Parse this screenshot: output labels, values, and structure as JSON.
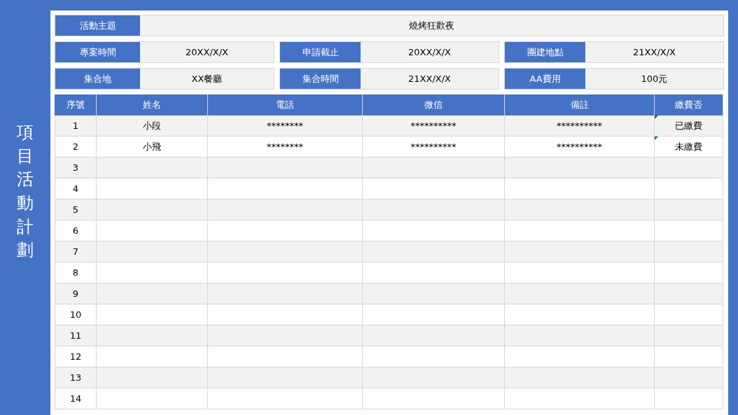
{
  "sidebar_title": "項目活動計劃",
  "info_rows": [
    [
      {
        "label": "活動主題",
        "value": "燒烤狂歡夜"
      }
    ],
    [
      {
        "label": "專案時間",
        "value": "20XX/X/X"
      },
      {
        "label": "申請截止",
        "value": "20XX/X/X"
      },
      {
        "label": "團建地點",
        "value": "21XX/X/X"
      }
    ],
    [
      {
        "label": "集合地",
        "value": "XX餐廳"
      },
      {
        "label": "集合時間",
        "value": "21XX/X/X"
      },
      {
        "label": "AA費用",
        "value": "100元"
      }
    ]
  ],
  "table": {
    "columns": [
      "序號",
      "姓名",
      "電話",
      "微信",
      "備註",
      "繳費否"
    ],
    "rows": [
      {
        "cells": [
          "1",
          "小段",
          "********",
          "**********",
          "**********",
          "已繳費"
        ],
        "comment_marker": true
      },
      {
        "cells": [
          "2",
          "小飛",
          "********",
          "**********",
          "**********",
          "未繳費"
        ],
        "comment_marker": true
      },
      {
        "cells": [
          "3"
        ]
      },
      {
        "cells": [
          "4"
        ]
      },
      {
        "cells": [
          "5"
        ]
      },
      {
        "cells": [
          "6"
        ]
      },
      {
        "cells": [
          "7"
        ]
      },
      {
        "cells": [
          "8"
        ]
      },
      {
        "cells": [
          "9"
        ]
      },
      {
        "cells": [
          "10"
        ]
      },
      {
        "cells": [
          "11"
        ]
      },
      {
        "cells": [
          "12"
        ]
      },
      {
        "cells": [
          "13"
        ]
      },
      {
        "cells": [
          "14"
        ]
      }
    ]
  }
}
